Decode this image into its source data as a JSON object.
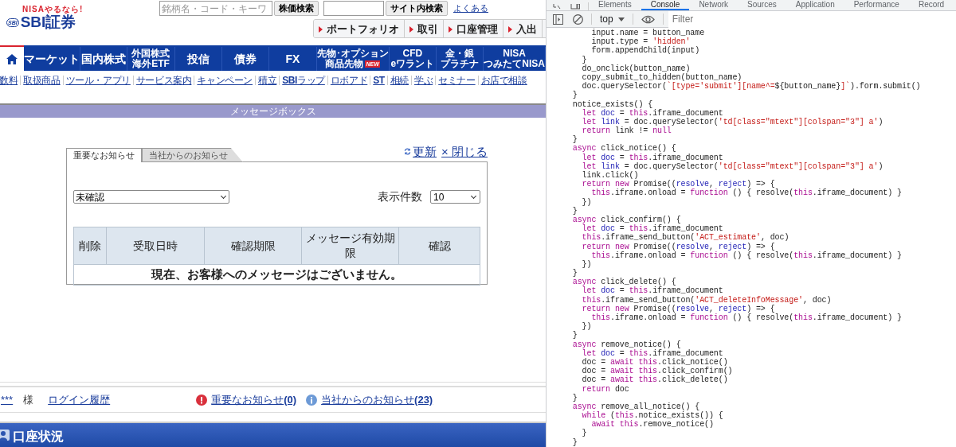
{
  "header": {
    "tagline": "NISAやるなら!",
    "logo_badge": "SBI",
    "logo_text": "SBI証券",
    "search_field": {
      "placeholder": "銘柄名・コード・キーワ"
    },
    "stock_search_button": "株価検索",
    "site_search_button": "サイト内検索",
    "help_link": "よくある",
    "quick_buttons": [
      "ポートフォリオ",
      "取引",
      "口座管理",
      "入出"
    ]
  },
  "main_nav": [
    {
      "kind": "home",
      "selected": true
    },
    {
      "kind": "item",
      "selected": false,
      "lines": [
        "マーケット"
      ]
    },
    {
      "kind": "item",
      "selected": false,
      "lines": [
        "国内株式"
      ]
    },
    {
      "kind": "item",
      "selected": false,
      "lines": [
        "外国株式",
        "海外ETF"
      ]
    },
    {
      "kind": "item",
      "selected": false,
      "lines": [
        "投信"
      ]
    },
    {
      "kind": "item",
      "selected": false,
      "lines": [
        "債券"
      ]
    },
    {
      "kind": "item",
      "selected": false,
      "lines": [
        "FX"
      ]
    },
    {
      "kind": "item",
      "selected": false,
      "lines": [
        "先物･オプション",
        "商品先物"
      ],
      "badge": "NEW"
    },
    {
      "kind": "item",
      "selected": false,
      "lines": [
        "CFD",
        "eワラント"
      ]
    },
    {
      "kind": "item",
      "selected": false,
      "lines": [
        "金・銀",
        "プラチナ"
      ]
    },
    {
      "kind": "item",
      "selected": false,
      "lines": [
        "NISA",
        "つみたてNISA"
      ]
    }
  ],
  "sub_links": [
    {
      "text": "数料",
      "bold": false
    },
    {
      "text": "取扱商品",
      "bold": false
    },
    {
      "text": "ツール・アプリ",
      "bold": false
    },
    {
      "text": "サービス案内",
      "bold": false
    },
    {
      "text": "キャンペーン",
      "bold": false
    },
    {
      "text": "積立",
      "bold": false
    },
    {
      "text": "**SBI**ラップ",
      "bold": false
    },
    {
      "text": "ロボアド",
      "bold": false
    },
    {
      "text": "ST",
      "bold": true
    },
    {
      "text": "相続",
      "bold": false
    },
    {
      "text": "学ぶ",
      "bold": false
    },
    {
      "text": "セミナー",
      "bold": false
    },
    {
      "text": "お店で相談",
      "bold": false
    }
  ],
  "message_box": {
    "title": "メッセージボックス",
    "tabs": [
      {
        "label": "重要なお知らせ",
        "selected": true
      },
      {
        "label": "当社からのお知らせ",
        "selected": false
      }
    ],
    "refresh_link": "更新",
    "close_link": "× 閉じる",
    "status_filter": {
      "value": "未確認"
    },
    "page_size_label": "表示件数",
    "page_size": {
      "value": "10"
    },
    "table": {
      "columns": [
        "削除",
        "受取日時",
        "確認期限",
        "メッセージ有効期限",
        "確認"
      ],
      "empty_message": "現在、お客様へのメッセージはございません。"
    }
  },
  "footer": {
    "user_link": "***",
    "honorific": "様",
    "login_history_link": "ログイン履歴",
    "important_link": "重要なお知らせ**(0)**",
    "company_link": "当社からのお知らせ**(23)**"
  },
  "account_bar": {
    "title": "口座状況"
  },
  "devtools": {
    "tabs": [
      {
        "label": "Elements",
        "selected": false
      },
      {
        "label": "Console",
        "selected": true
      },
      {
        "label": "Network",
        "selected": false
      },
      {
        "label": "Sources",
        "selected": false
      },
      {
        "label": "Application",
        "selected": false
      },
      {
        "label": "Performance",
        "selected": false
      },
      {
        "label": "Record",
        "selected": false
      }
    ],
    "context": "top",
    "filter": {
      "placeholder": "Filter"
    },
    "code_lines": [
      {
        "tokens": [
          {
            "kind": "plain",
            "text": "      input.name = button_name"
          }
        ]
      },
      {
        "tokens": [
          {
            "kind": "plain",
            "text": "      input.type = "
          },
          {
            "kind": "string",
            "text": "'hidden'"
          }
        ]
      },
      {
        "tokens": [
          {
            "kind": "plain",
            "text": "      form.appendChild(input)"
          }
        ]
      },
      {
        "tokens": [
          {
            "kind": "plain",
            "text": "    }"
          }
        ]
      },
      {
        "tokens": [
          {
            "kind": "plain",
            "text": "    do_onclick(button_name)"
          }
        ]
      },
      {
        "tokens": [
          {
            "kind": "plain",
            "text": "    copy_submit_to_hidden(button_name)"
          }
        ]
      },
      {
        "tokens": [
          {
            "kind": "plain",
            "text": "    doc.querySelector("
          },
          {
            "kind": "string",
            "text": "`[type='submit'][name^="
          },
          {
            "kind": "plain",
            "text": "${button_name}"
          },
          {
            "kind": "string",
            "text": "]`"
          },
          {
            "kind": "plain",
            "text": ").form.submit()"
          }
        ]
      },
      {
        "tokens": [
          {
            "kind": "plain",
            "text": "  }"
          }
        ]
      },
      {
        "tokens": [
          {
            "kind": "plain",
            "text": "  notice_exists() {"
          }
        ]
      },
      {
        "tokens": [
          {
            "kind": "keyword",
            "text": "    let "
          },
          {
            "kind": "variable",
            "text": "doc"
          },
          {
            "kind": "plain",
            "text": " = "
          },
          {
            "kind": "keyword",
            "text": "this"
          },
          {
            "kind": "plain",
            "text": ".iframe_document"
          }
        ]
      },
      {
        "tokens": [
          {
            "kind": "keyword",
            "text": "    let "
          },
          {
            "kind": "variable",
            "text": "link"
          },
          {
            "kind": "plain",
            "text": " = doc.querySelector("
          },
          {
            "kind": "string",
            "text": "'td[class=\"mtext\"][colspan=\"3\"] a'"
          },
          {
            "kind": "plain",
            "text": ")"
          }
        ]
      },
      {
        "tokens": [
          {
            "kind": "keyword",
            "text": "    return"
          },
          {
            "kind": "plain",
            "text": " link != "
          },
          {
            "kind": "keyword",
            "text": "null"
          }
        ]
      },
      {
        "tokens": [
          {
            "kind": "plain",
            "text": "  }"
          }
        ]
      },
      {
        "tokens": [
          {
            "kind": "keyword",
            "text": "  async"
          },
          {
            "kind": "plain",
            "text": " click_notice() {"
          }
        ]
      },
      {
        "tokens": [
          {
            "kind": "keyword",
            "text": "    let "
          },
          {
            "kind": "variable",
            "text": "doc"
          },
          {
            "kind": "plain",
            "text": " = "
          },
          {
            "kind": "keyword",
            "text": "this"
          },
          {
            "kind": "plain",
            "text": ".iframe_document"
          }
        ]
      },
      {
        "tokens": [
          {
            "kind": "keyword",
            "text": "    let "
          },
          {
            "kind": "variable",
            "text": "link"
          },
          {
            "kind": "plain",
            "text": " = doc.querySelector("
          },
          {
            "kind": "string",
            "text": "'td[class=\"mtext\"][colspan=\"3\"] a'"
          },
          {
            "kind": "plain",
            "text": ")"
          }
        ]
      },
      {
        "tokens": [
          {
            "kind": "plain",
            "text": "    link.click()"
          }
        ]
      },
      {
        "tokens": [
          {
            "kind": "keyword",
            "text": "    return new"
          },
          {
            "kind": "plain",
            "text": " Promise(("
          },
          {
            "kind": "variable",
            "text": "resolve"
          },
          {
            "kind": "plain",
            "text": ", "
          },
          {
            "kind": "variable",
            "text": "reject"
          },
          {
            "kind": "plain",
            "text": ") => {"
          }
        ]
      },
      {
        "tokens": [
          {
            "kind": "keyword",
            "text": "      this"
          },
          {
            "kind": "plain",
            "text": ".iframe.onload = "
          },
          {
            "kind": "keyword",
            "text": "function"
          },
          {
            "kind": "plain",
            "text": " () { resolve("
          },
          {
            "kind": "keyword",
            "text": "this"
          },
          {
            "kind": "plain",
            "text": ".iframe_document) }"
          }
        ]
      },
      {
        "tokens": [
          {
            "kind": "plain",
            "text": "    })"
          }
        ]
      },
      {
        "tokens": [
          {
            "kind": "plain",
            "text": "  }"
          }
        ]
      },
      {
        "tokens": [
          {
            "kind": "keyword",
            "text": "  async"
          },
          {
            "kind": "plain",
            "text": " click_confirm() {"
          }
        ]
      },
      {
        "tokens": [
          {
            "kind": "keyword",
            "text": "    let "
          },
          {
            "kind": "variable",
            "text": "doc"
          },
          {
            "kind": "plain",
            "text": " = "
          },
          {
            "kind": "keyword",
            "text": "this"
          },
          {
            "kind": "plain",
            "text": ".iframe_document"
          }
        ]
      },
      {
        "tokens": [
          {
            "kind": "keyword",
            "text": "    this"
          },
          {
            "kind": "plain",
            "text": ".iframe_send_button("
          },
          {
            "kind": "string",
            "text": "'ACT_estimate'"
          },
          {
            "kind": "plain",
            "text": ", doc)"
          }
        ]
      },
      {
        "tokens": [
          {
            "kind": "keyword",
            "text": "    return new"
          },
          {
            "kind": "plain",
            "text": " Promise(("
          },
          {
            "kind": "variable",
            "text": "resolve"
          },
          {
            "kind": "plain",
            "text": ", "
          },
          {
            "kind": "variable",
            "text": "reject"
          },
          {
            "kind": "plain",
            "text": ") => {"
          }
        ]
      },
      {
        "tokens": [
          {
            "kind": "keyword",
            "text": "      this"
          },
          {
            "kind": "plain",
            "text": ".iframe.onload = "
          },
          {
            "kind": "keyword",
            "text": "function"
          },
          {
            "kind": "plain",
            "text": " () { resolve("
          },
          {
            "kind": "keyword",
            "text": "this"
          },
          {
            "kind": "plain",
            "text": ".iframe_document) }"
          }
        ]
      },
      {
        "tokens": [
          {
            "kind": "plain",
            "text": "    })"
          }
        ]
      },
      {
        "tokens": [
          {
            "kind": "plain",
            "text": "  }"
          }
        ]
      },
      {
        "tokens": [
          {
            "kind": "keyword",
            "text": "  async"
          },
          {
            "kind": "plain",
            "text": " click_delete() {"
          }
        ]
      },
      {
        "tokens": [
          {
            "kind": "keyword",
            "text": "    let "
          },
          {
            "kind": "variable",
            "text": "doc"
          },
          {
            "kind": "plain",
            "text": " = "
          },
          {
            "kind": "keyword",
            "text": "this"
          },
          {
            "kind": "plain",
            "text": ".iframe_document"
          }
        ]
      },
      {
        "tokens": [
          {
            "kind": "keyword",
            "text": "    this"
          },
          {
            "kind": "plain",
            "text": ".iframe_send_button("
          },
          {
            "kind": "string",
            "text": "'ACT_deleteInfoMessage'"
          },
          {
            "kind": "plain",
            "text": ", doc)"
          }
        ]
      },
      {
        "tokens": [
          {
            "kind": "keyword",
            "text": "    return new"
          },
          {
            "kind": "plain",
            "text": " Promise(("
          },
          {
            "kind": "variable",
            "text": "resolve"
          },
          {
            "kind": "plain",
            "text": ", "
          },
          {
            "kind": "variable",
            "text": "reject"
          },
          {
            "kind": "plain",
            "text": ") => {"
          }
        ]
      },
      {
        "tokens": [
          {
            "kind": "keyword",
            "text": "      this"
          },
          {
            "kind": "plain",
            "text": ".iframe.onload = "
          },
          {
            "kind": "keyword",
            "text": "function"
          },
          {
            "kind": "plain",
            "text": " () { resolve("
          },
          {
            "kind": "keyword",
            "text": "this"
          },
          {
            "kind": "plain",
            "text": ".iframe_document) }"
          }
        ]
      },
      {
        "tokens": [
          {
            "kind": "plain",
            "text": "    })"
          }
        ]
      },
      {
        "tokens": [
          {
            "kind": "plain",
            "text": "  }"
          }
        ]
      },
      {
        "tokens": [
          {
            "kind": "keyword",
            "text": "  async"
          },
          {
            "kind": "plain",
            "text": " remove_notice() {"
          }
        ]
      },
      {
        "tokens": [
          {
            "kind": "keyword",
            "text": "    let "
          },
          {
            "kind": "variable",
            "text": "doc"
          },
          {
            "kind": "plain",
            "text": " = "
          },
          {
            "kind": "keyword",
            "text": "this"
          },
          {
            "kind": "plain",
            "text": ".iframe_document"
          }
        ]
      },
      {
        "tokens": [
          {
            "kind": "plain",
            "text": "    doc = "
          },
          {
            "kind": "keyword",
            "text": "await this"
          },
          {
            "kind": "plain",
            "text": ".click_notice()"
          }
        ]
      },
      {
        "tokens": [
          {
            "kind": "plain",
            "text": "    doc = "
          },
          {
            "kind": "keyword",
            "text": "await this"
          },
          {
            "kind": "plain",
            "text": ".click_confirm()"
          }
        ]
      },
      {
        "tokens": [
          {
            "kind": "plain",
            "text": "    doc = "
          },
          {
            "kind": "keyword",
            "text": "await this"
          },
          {
            "kind": "plain",
            "text": ".click_delete()"
          }
        ]
      },
      {
        "tokens": [
          {
            "kind": "keyword",
            "text": "    return"
          },
          {
            "kind": "plain",
            "text": " doc"
          }
        ]
      },
      {
        "tokens": [
          {
            "kind": "plain",
            "text": "  }"
          }
        ]
      },
      {
        "tokens": [
          {
            "kind": "keyword",
            "text": "  async"
          },
          {
            "kind": "plain",
            "text": " remove_all_notice() {"
          }
        ]
      },
      {
        "tokens": [
          {
            "kind": "keyword",
            "text": "    while"
          },
          {
            "kind": "plain",
            "text": " ("
          },
          {
            "kind": "keyword",
            "text": "this"
          },
          {
            "kind": "plain",
            "text": ".notice_exists()) {"
          }
        ]
      },
      {
        "tokens": [
          {
            "kind": "keyword",
            "text": "      await this"
          },
          {
            "kind": "plain",
            "text": ".remove_notice()"
          }
        ]
      },
      {
        "tokens": [
          {
            "kind": "plain",
            "text": "    }"
          }
        ]
      },
      {
        "tokens": [
          {
            "kind": "plain",
            "text": "  }"
          }
        ]
      }
    ]
  }
}
